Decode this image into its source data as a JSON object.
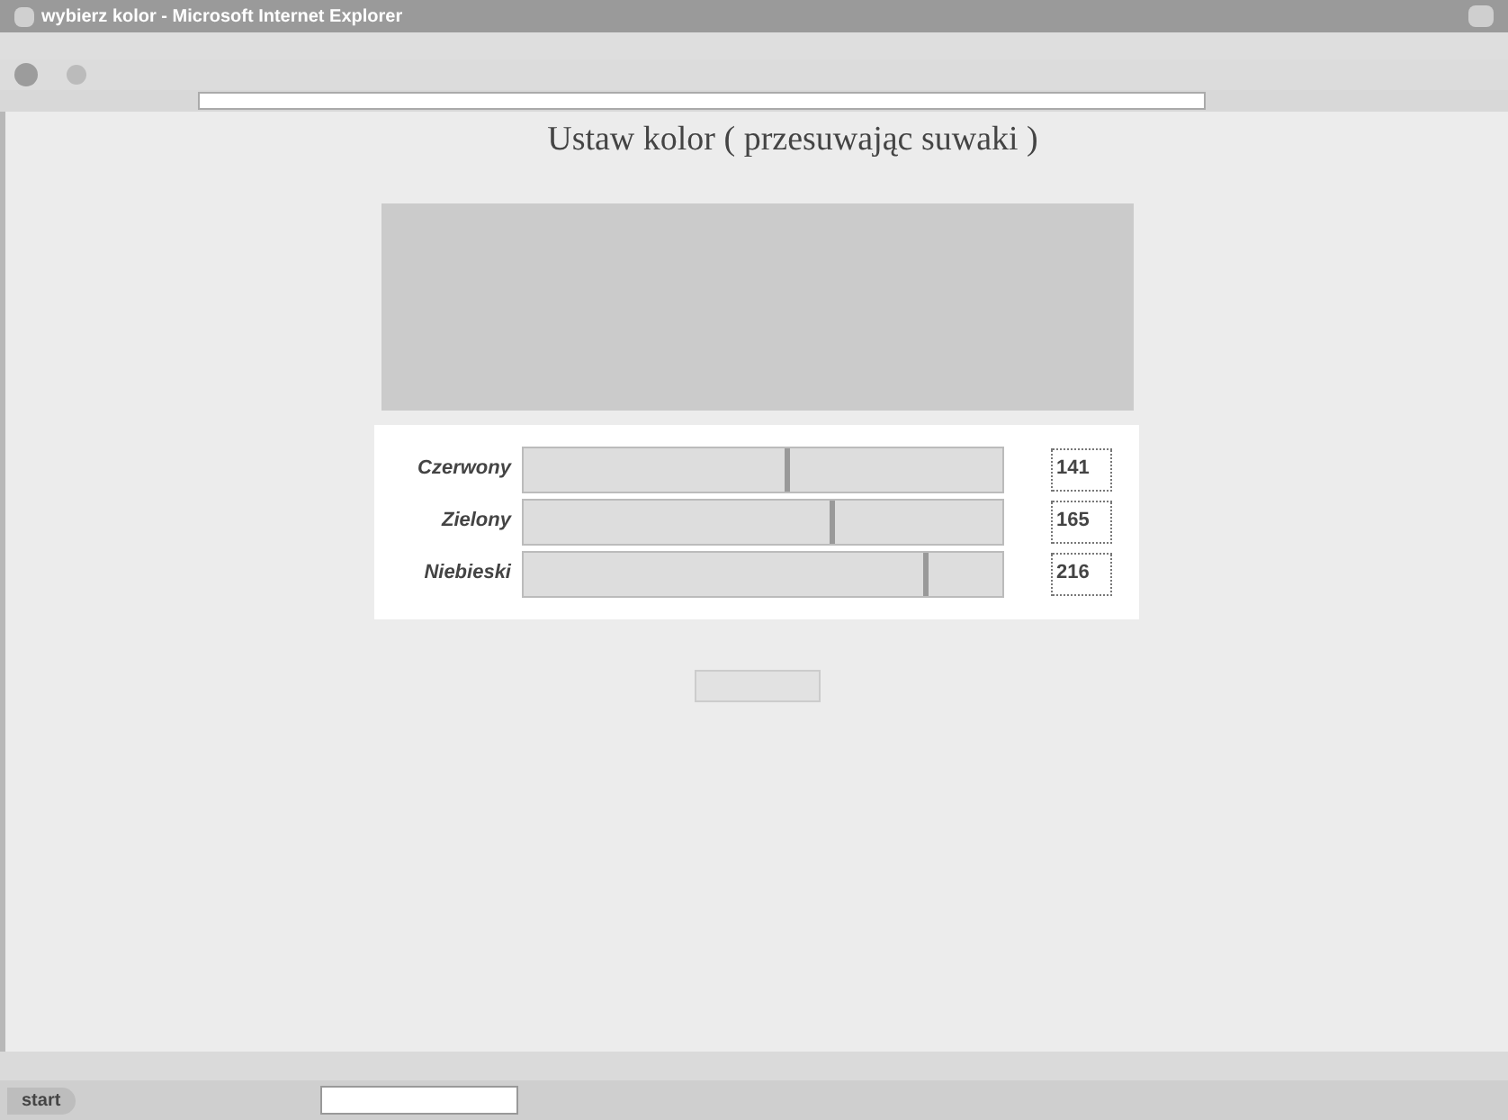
{
  "window": {
    "title": "wybierz kolor - Microsoft Internet Explorer"
  },
  "page": {
    "heading": "Ustaw kolor ( przesuwając suwaki )",
    "channels": [
      {
        "name": "Czerwony",
        "level": 0.553,
        "value": "141"
      },
      {
        "name": "Zielony",
        "level": 0.647,
        "value": "165"
      },
      {
        "name": "Niebieski",
        "level": 0.847,
        "value": "216"
      }
    ]
  },
  "taskbar": {
    "start": "start"
  }
}
